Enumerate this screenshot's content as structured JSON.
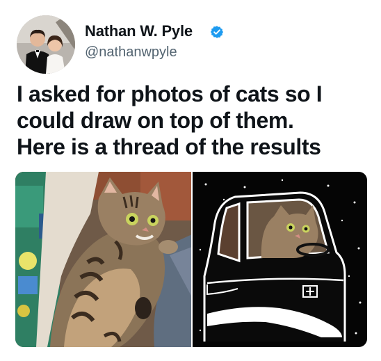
{
  "author": {
    "name": "Nathan W. Pyle",
    "handle": "@nathanwpyle",
    "verified": true
  },
  "tweet": {
    "lines": [
      "I asked for photos of cats so I",
      "could draw on top of them.",
      "Here is a thread of the results"
    ]
  },
  "media": {
    "items": [
      {
        "kind": "photo",
        "subject": "tabby cat lying on its back"
      },
      {
        "kind": "drawing",
        "subject": "same cat drawn driving a car at night"
      }
    ]
  },
  "colors": {
    "verified_blue": "#1d9bf0",
    "handle_gray": "#536471",
    "text": "#0f1419"
  }
}
